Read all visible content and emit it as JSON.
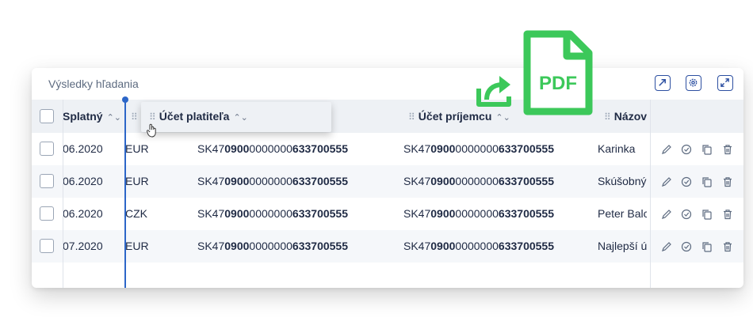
{
  "card": {
    "title": "Výsledky hľadania"
  },
  "header_icons": [
    "open-external-icon",
    "settings-icon",
    "expand-icon"
  ],
  "columns": {
    "splatny": "Splatný",
    "ucet_platitela": "Účet platiteľa",
    "ucet_prijemcu": "Účet príjemcu",
    "nazov": "Názov"
  },
  "rows": [
    {
      "date": "06.2020",
      "currency": "EUR",
      "payer": {
        "a": "SK47",
        "b": "0900",
        "c": "0000000",
        "d": "633700555"
      },
      "payee": {
        "a": "SK47",
        "b": "0900",
        "c": "0000000",
        "d": "633700555"
      },
      "name": "Karinka"
    },
    {
      "date": "06.2020",
      "currency": "EUR",
      "payer": {
        "a": "SK47",
        "b": "0900",
        "c": "0000000",
        "d": "633700555"
      },
      "payee": {
        "a": "SK47",
        "b": "0900",
        "c": "0000000",
        "d": "633700555"
      },
      "name": "Skúšobný"
    },
    {
      "date": "06.2020",
      "currency": "CZK",
      "payer": {
        "a": "SK47",
        "b": "0900",
        "c": "0000000",
        "d": "633700555"
      },
      "payee": {
        "a": "SK47",
        "b": "0900",
        "c": "0000000",
        "d": "633700555"
      },
      "name": "Peter Balc"
    },
    {
      "date": "07.2020",
      "currency": "EUR",
      "payer": {
        "a": "SK47",
        "b": "0900",
        "c": "0000000",
        "d": "633700555"
      },
      "payee": {
        "a": "SK47",
        "b": "0900",
        "c": "0000000",
        "d": "633700555"
      },
      "name": "Najlepší ú"
    }
  ],
  "row_actions": [
    "edit-icon",
    "approve-icon",
    "copy-icon",
    "delete-icon"
  ],
  "overlay": {
    "pdf_label": "PDF"
  },
  "colors": {
    "accent": "#2c66c8",
    "pdf_green": "#3cc85a",
    "text": "#1f2a44",
    "header_bg": "#eef1f5"
  }
}
